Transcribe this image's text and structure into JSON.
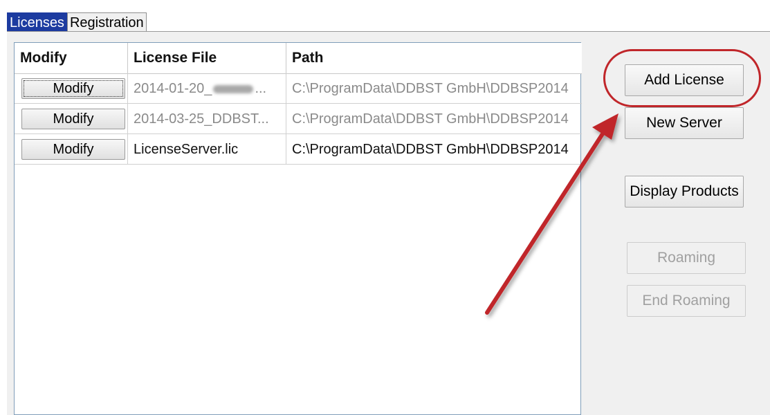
{
  "tabs": [
    {
      "label": "Licenses",
      "active": true
    },
    {
      "label": "Registration",
      "active": false
    }
  ],
  "table": {
    "columns": [
      "Modify",
      "License File",
      "Path"
    ],
    "rows": [
      {
        "button": "Modify",
        "license_file_prefix": "2014-01-20_",
        "license_file_suffix": "...",
        "license_file_redacted": true,
        "path": "C:\\ProgramData\\DDBST GmbH\\DDBSP2014",
        "muted": true
      },
      {
        "button": "Modify",
        "license_file": "2014-03-25_DDBST...",
        "path": "C:\\ProgramData\\DDBST GmbH\\DDBSP2014",
        "muted": true
      },
      {
        "button": "Modify",
        "license_file": "LicenseServer.lic",
        "path": "C:\\ProgramData\\DDBST GmbH\\DDBSP2014",
        "muted": false
      }
    ]
  },
  "buttons": {
    "add_license": "Add License",
    "new_server": "New Server",
    "display_products": "Display Products",
    "roaming": "Roaming",
    "end_roaming": "End Roaming"
  },
  "colors": {
    "active_tab": "#1c3ba0",
    "annotation": "#c0262a",
    "muted_text": "#8a8a8a"
  }
}
